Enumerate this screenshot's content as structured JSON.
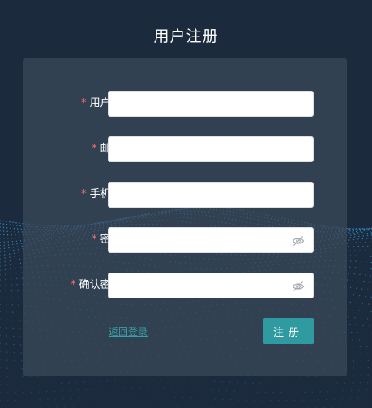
{
  "page": {
    "title": "用户注册"
  },
  "form": {
    "fields": [
      {
        "label": "用户名:",
        "value": "",
        "required": true,
        "type": "text"
      },
      {
        "label": "邮箱:",
        "value": "",
        "required": true,
        "type": "text"
      },
      {
        "label": "手机号:",
        "value": "",
        "required": true,
        "type": "text"
      },
      {
        "label": "密码:",
        "value": "",
        "required": true,
        "type": "password",
        "icon": "eye-off-icon"
      },
      {
        "label": "确认密码:",
        "value": "",
        "required": true,
        "type": "password",
        "icon": "eye-off-icon"
      }
    ],
    "required_mark": "*",
    "back_link": "返回登录",
    "submit_label": "注册"
  },
  "colors": {
    "background": "#1b2a3c",
    "accent": "#2f9aa0",
    "required": "#f56c6c",
    "wave": "#3aa0e0"
  }
}
